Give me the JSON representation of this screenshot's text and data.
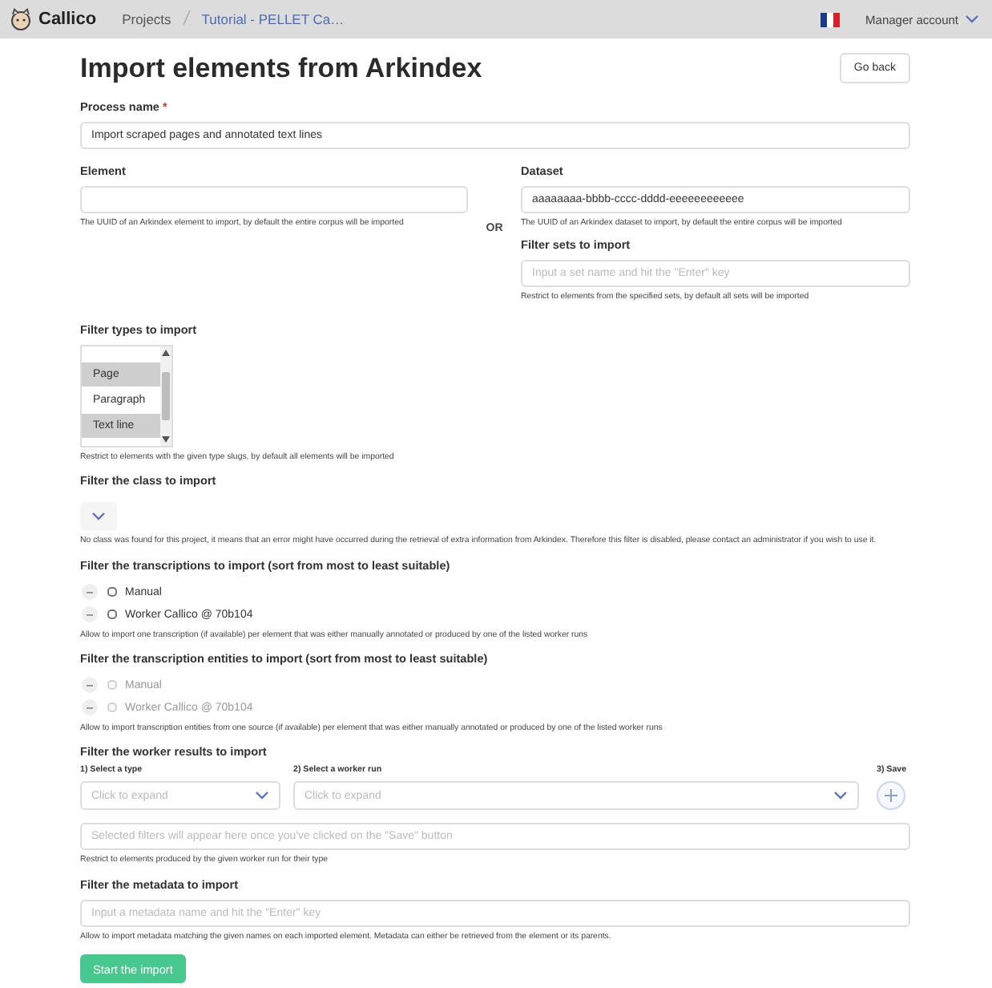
{
  "navbar": {
    "brand": "Callico",
    "breadcrumbs": [
      {
        "label": "Projects",
        "link": false
      },
      {
        "label": "Tutorial - PELLET Ca…",
        "link": true
      }
    ],
    "account": "Manager account"
  },
  "page": {
    "title": "Import elements from Arkindex",
    "back_button": "Go back"
  },
  "process_name": {
    "label": "Process name",
    "required_mark": "*",
    "value": "Import scraped pages and annotated text lines"
  },
  "element": {
    "label": "Element",
    "help": "The UUID of an Arkindex element to import, by default the entire corpus will be imported"
  },
  "separator": "OR",
  "dataset": {
    "label": "Dataset",
    "value": "aaaaaaaa-bbbb-cccc-dddd-eeeeeeeeeeee",
    "help": "The UUID of an Arkindex dataset to import, by default the entire corpus will be imported"
  },
  "sets": {
    "label": "Filter sets to import",
    "placeholder": "Input a set name and hit the \"Enter\" key",
    "help": "Restrict to elements from the specified sets, by default all sets will be imported"
  },
  "types": {
    "label": "Filter types to import",
    "options": [
      {
        "label": "Page",
        "selected": true
      },
      {
        "label": "Paragraph",
        "selected": false
      },
      {
        "label": "Text line",
        "selected": true
      }
    ],
    "help": "Restrict to elements with the given type slugs, by default all elements will be imported"
  },
  "class_filter": {
    "label": "Filter the class to import",
    "disabled": true,
    "help": "No class was found for this project, it means that an error might have occurred during the retrieval of extra information from Arkindex. Therefore this filter is disabled, please contact an administrator if you wish to use it."
  },
  "transcriptions": {
    "label": "Filter the transcriptions to import (sort from most to least suitable)",
    "sources": [
      {
        "label": "Manual",
        "checked": false,
        "disabled": false
      },
      {
        "label": "Worker Callico @ 70b104",
        "checked": false,
        "disabled": false
      }
    ],
    "help": "Allow to import one transcription (if available) per element that was either manually annotated or produced by one of the listed worker runs"
  },
  "entities": {
    "label": "Filter the transcription entities to import (sort from most to least suitable)",
    "sources": [
      {
        "label": "Manual",
        "checked": false,
        "disabled": true
      },
      {
        "label": "Worker Callico @ 70b104",
        "checked": false,
        "disabled": true
      }
    ],
    "help": "Allow to import transcription entities from one source (if available) per element that was either manually annotated or produced by one of the listed worker runs"
  },
  "worker_results": {
    "label": "Filter the worker results to import",
    "type_select": {
      "label": "1) Select a type",
      "placeholder": "Click to expand"
    },
    "run_select": {
      "label": "2) Select a worker run",
      "placeholder": "Click to expand"
    },
    "save_label": "3) Save",
    "filters_placeholder": "Selected filters will appear here once you've clicked on the \"Save\" button",
    "help": "Restrict to elements produced by the given worker run for their type"
  },
  "metadata": {
    "label": "Filter the metadata to import",
    "placeholder": "Input a metadata name and hit the \"Enter\" key",
    "help": "Allow to import metadata matching the given names on each imported element. Metadata can either be retrieved from the element or its parents."
  },
  "submit": "Start the import"
}
